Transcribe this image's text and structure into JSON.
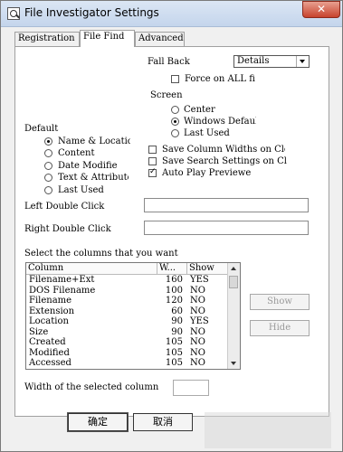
{
  "window": {
    "title": "File Investigator Settings",
    "close_glyph": "✕"
  },
  "tabs": [
    {
      "label": "Registration",
      "active": false
    },
    {
      "label": "File Find",
      "active": true
    },
    {
      "label": "Advanced",
      "active": false
    }
  ],
  "fall_back": {
    "label": "Fall Back",
    "select_value": "Details",
    "force_label": "Force on ALL fi",
    "force_checked": false
  },
  "screen": {
    "label": "Screen",
    "options": [
      {
        "label": "Center",
        "selected": false
      },
      {
        "label": "Windows Default",
        "selected": true
      },
      {
        "label": "Last Used",
        "selected": false
      }
    ]
  },
  "default": {
    "label": "Default",
    "options": [
      {
        "label": "Name & Location",
        "selected": true
      },
      {
        "label": "Content",
        "selected": false
      },
      {
        "label": "Date Modified",
        "selected": false
      },
      {
        "label": "Text & Attributes",
        "selected": false
      },
      {
        "label": "Last Used",
        "selected": false
      }
    ]
  },
  "checkboxes": [
    {
      "label": "Save Column Widths on Clo",
      "checked": false
    },
    {
      "label": "Save Search Settings on Cl",
      "checked": false
    },
    {
      "label": "Auto Play Previewe",
      "checked": true
    }
  ],
  "left_double_click": {
    "label": "Left Double Click",
    "value": ""
  },
  "right_double_click": {
    "label": "Right Double Click",
    "value": ""
  },
  "columns": {
    "prompt": "Select the columns that you want",
    "headers": [
      "Column",
      "W...",
      "Show"
    ],
    "rows": [
      [
        "Filename+Ext",
        "160",
        "YES"
      ],
      [
        "DOS Filename",
        "100",
        "NO"
      ],
      [
        "Filename",
        "120",
        "NO"
      ],
      [
        "Extension",
        "60",
        "NO"
      ],
      [
        "Location",
        "90",
        "YES"
      ],
      [
        "Size",
        "90",
        "NO"
      ],
      [
        "Created",
        "105",
        "NO"
      ],
      [
        "Modified",
        "105",
        "NO"
      ],
      [
        "Accessed",
        "105",
        "NO"
      ]
    ]
  },
  "side_buttons": {
    "show": "Show",
    "hide": "Hide"
  },
  "width_label": "Width of the selected column",
  "width_value": "",
  "footer": {
    "ok": "确定",
    "cancel": "取消"
  }
}
